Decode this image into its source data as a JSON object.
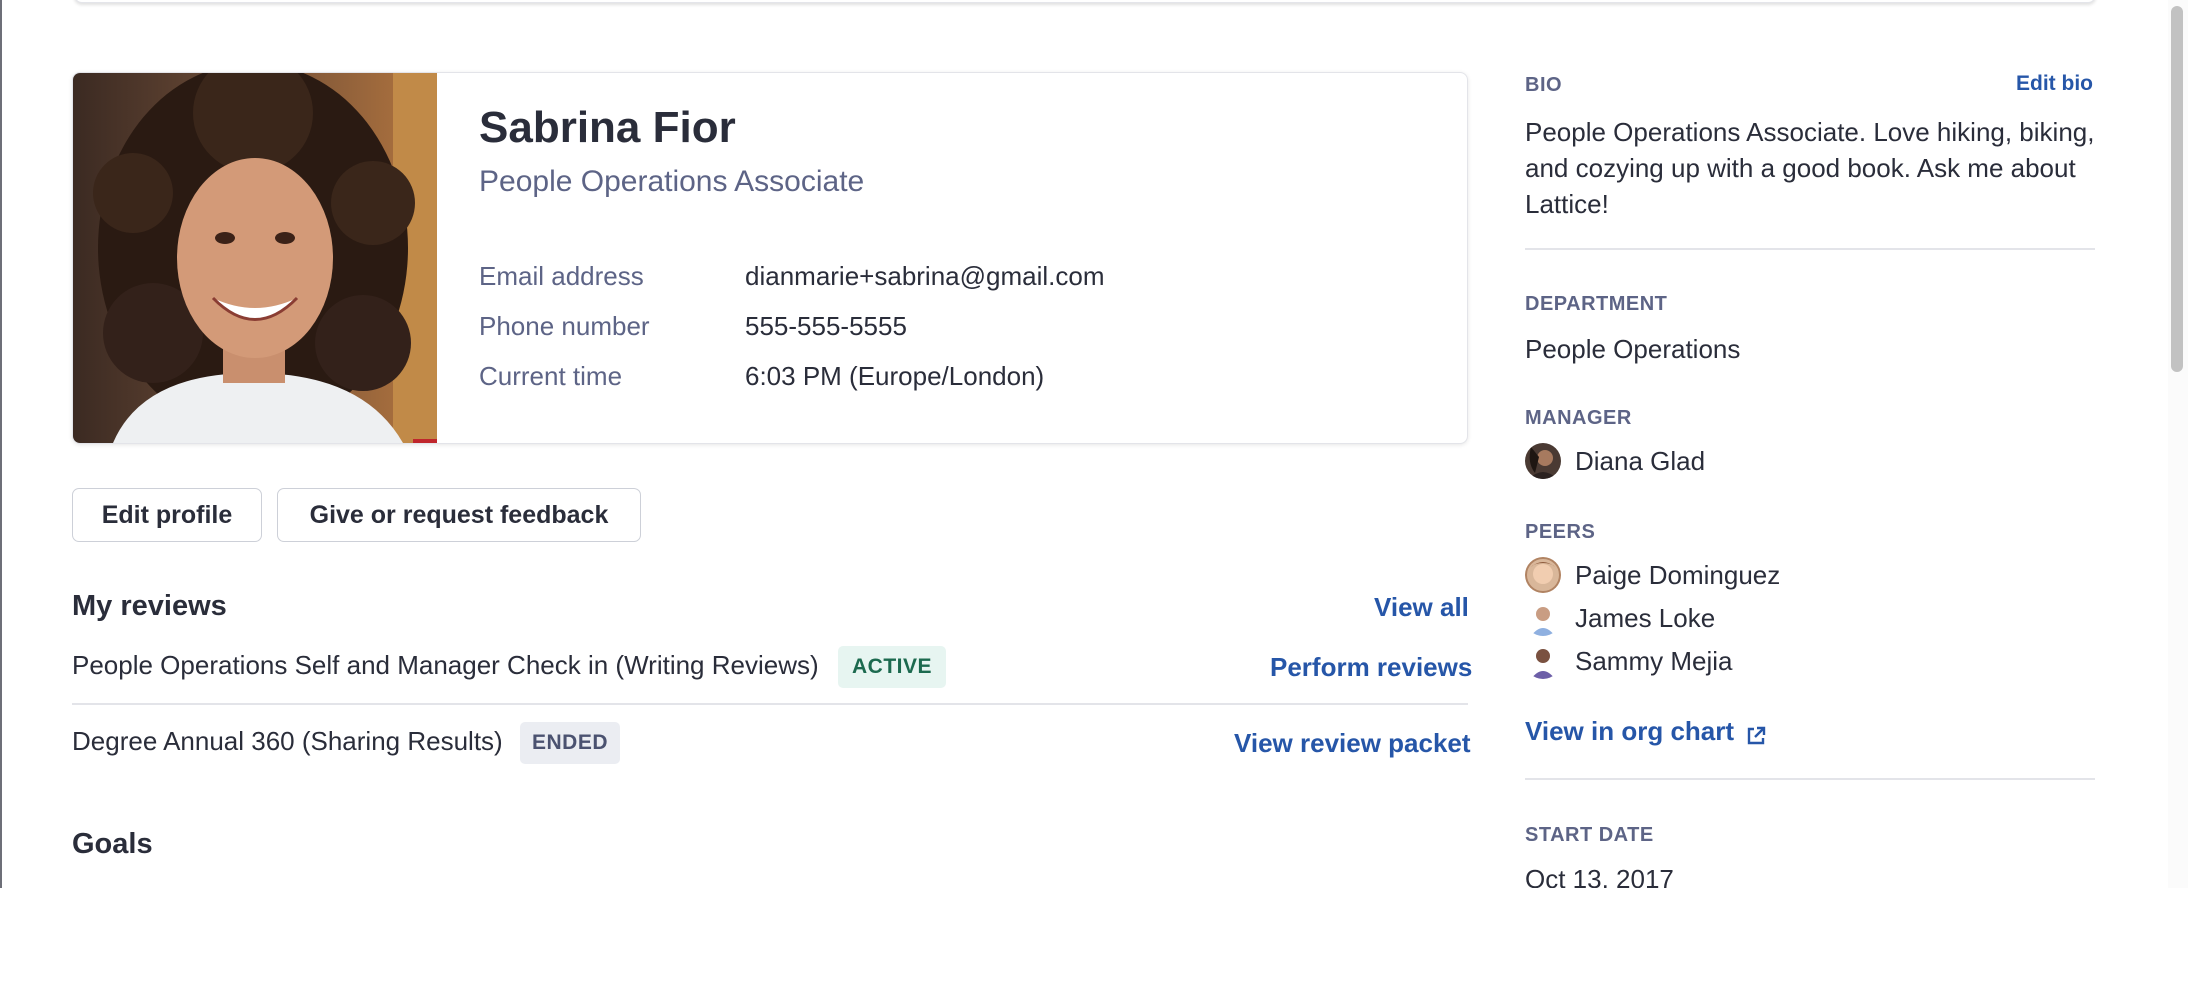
{
  "profile": {
    "name": "Sabrina Fior",
    "title": "People Operations Associate",
    "fields": [
      {
        "label": "Email address",
        "value": "dianmarie+sabrina@gmail.com"
      },
      {
        "label": "Phone number",
        "value": "555-555-5555"
      },
      {
        "label": "Current time",
        "value": "6:03 PM (Europe/London)"
      }
    ]
  },
  "actions": {
    "edit_profile": "Edit profile",
    "feedback": "Give or request feedback"
  },
  "reviews": {
    "heading": "My reviews",
    "view_all": "View all",
    "items": [
      {
        "name": "People Operations Self and Manager Check in (Writing Reviews)",
        "status": "ACTIVE",
        "action": "Perform reviews"
      },
      {
        "name": "Degree Annual 360 (Sharing Results)",
        "status": "ENDED",
        "action": "View review packet"
      }
    ]
  },
  "goals": {
    "heading": "Goals"
  },
  "sidebar": {
    "bio_label": "BIO",
    "edit_bio": "Edit bio",
    "bio_text": "People Operations Associate. Love hiking, biking, and cozying up with a good book. Ask me about Lattice!",
    "department_label": "DEPARTMENT",
    "department": "People Operations",
    "manager_label": "MANAGER",
    "manager": "Diana Glad",
    "peers_label": "PEERS",
    "peers": [
      "Paige Dominguez",
      "James Loke",
      "Sammy Mejia"
    ],
    "org_chart_link": "View in org chart",
    "start_date_label": "START DATE",
    "start_date": "Oct 13, 2017"
  },
  "colors": {
    "link": "#2656a8",
    "active_badge_bg": "#e7f5f1",
    "active_badge_text": "#1c6a4f",
    "ended_badge_bg": "#ebedf2",
    "ended_badge_text": "#4b5270"
  },
  "icons": {
    "external_link": "external-link-icon",
    "profile_photo": "profile-photo",
    "manager_avatar": "avatar",
    "peer_avatar": "avatar"
  }
}
